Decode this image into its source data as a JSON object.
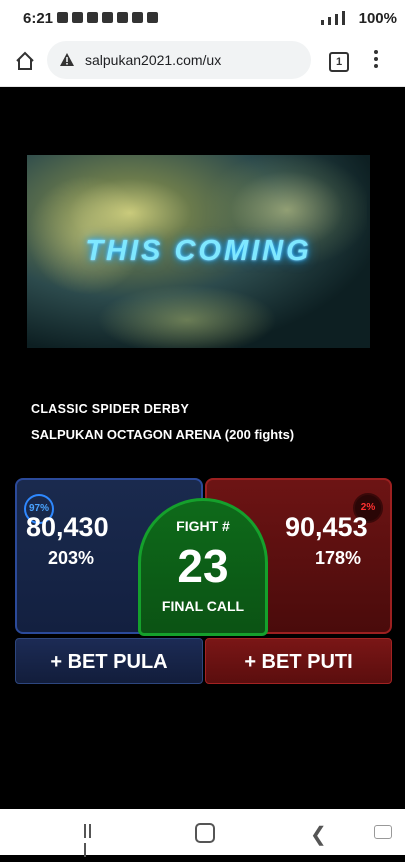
{
  "status_bar": {
    "time": "6:21",
    "battery": "100%"
  },
  "browser": {
    "url": "salpukan2021.com/ux",
    "tab_count": "1"
  },
  "banner": {
    "title": "THIS COMING"
  },
  "event": {
    "name": "CLASSIC SPIDER DERBY",
    "venue": "SALPUKAN OCTAGON ARENA (200 fights)"
  },
  "fight": {
    "label": "FIGHT #",
    "number": "23",
    "status": "FINAL CALL"
  },
  "pula": {
    "ring_percent": "97%",
    "amount": "80,430",
    "payout": "203%",
    "button": "+ BET PULA",
    "color": "#1a2a4e"
  },
  "puti": {
    "ring_percent": "2%",
    "amount": "90,453",
    "payout": "178%",
    "button": "+ BET PUTI",
    "color": "#6d1414"
  }
}
